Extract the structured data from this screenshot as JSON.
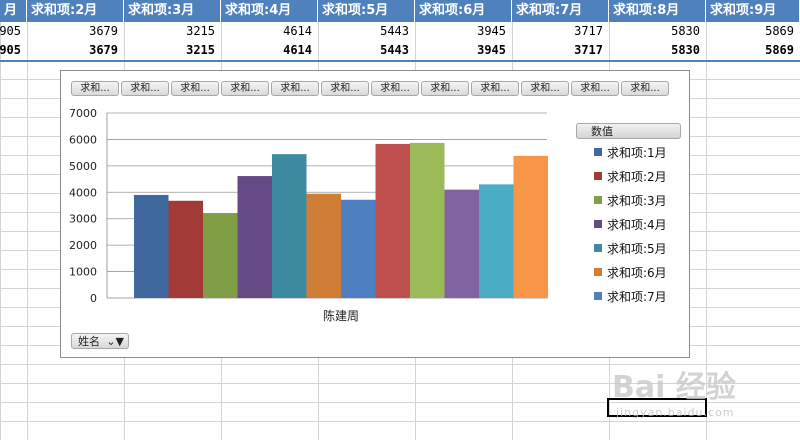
{
  "sheet": {
    "headers": [
      "月",
      "求和项:2月",
      "求和项:3月",
      "求和项:4月",
      "求和项:5月",
      "求和项:6月",
      "求和项:7月",
      "求和项:8月",
      "求和项:9月"
    ],
    "row1": [
      "905",
      "3679",
      "3215",
      "4614",
      "5443",
      "3945",
      "3717",
      "5830",
      "5869"
    ],
    "total_row": [
      "905",
      "3679",
      "3215",
      "4614",
      "5443",
      "3945",
      "3717",
      "5830",
      "5869"
    ],
    "header_color": "#4f81bd"
  },
  "chart": {
    "field_buttons": [
      "求和...",
      "求和...",
      "求和...",
      "求和...",
      "求和...",
      "求和...",
      "求和...",
      "求和...",
      "求和...",
      "求和...",
      "求和...",
      "求和..."
    ],
    "legend_title": "数值",
    "filter_label": "姓名",
    "filter_icon": "funnel-icon"
  },
  "chart_data": {
    "type": "bar",
    "categories": [
      "陈建周"
    ],
    "xlabel": "陈建周",
    "ylim": [
      0,
      7000
    ],
    "yticks": [
      0,
      1000,
      2000,
      3000,
      4000,
      5000,
      6000,
      7000
    ],
    "grid": true,
    "legend_placement": "right",
    "series": [
      {
        "name": "求和项:1月",
        "values": [
          3900
        ],
        "color": "#3f689e"
      },
      {
        "name": "求和项:2月",
        "values": [
          3679
        ],
        "color": "#a23b38"
      },
      {
        "name": "求和项:3月",
        "values": [
          3215
        ],
        "color": "#809e45"
      },
      {
        "name": "求和项:4月",
        "values": [
          4614
        ],
        "color": "#654a86"
      },
      {
        "name": "求和项:5月",
        "values": [
          5443
        ],
        "color": "#3b8aa0"
      },
      {
        "name": "求和项:6月",
        "values": [
          3945
        ],
        "color": "#d07d36"
      },
      {
        "name": "求和项:7月",
        "values": [
          3717
        ],
        "color": "#4d7fc1"
      },
      {
        "name": "",
        "values": [
          5830
        ],
        "color": "#c0504d"
      },
      {
        "name": "",
        "values": [
          5869
        ],
        "color": "#9bbb59"
      },
      {
        "name": "",
        "values": [
          4100
        ],
        "color": "#8064a2"
      },
      {
        "name": "",
        "values": [
          4300
        ],
        "color": "#4bacc6"
      },
      {
        "name": "",
        "values": [
          5380
        ],
        "color": "#f79646"
      }
    ],
    "legend_visible_count": 7
  },
  "watermark": {
    "text": "Bai 经验",
    "sub": "jingyan.baidu.com"
  }
}
